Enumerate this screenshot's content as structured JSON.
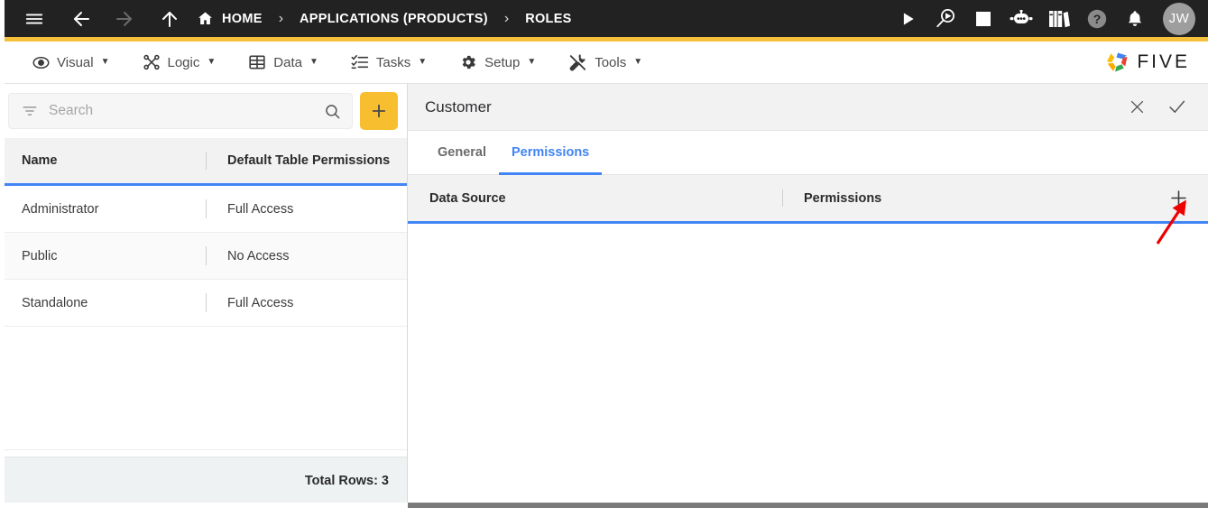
{
  "topbar": {
    "background": "#222222",
    "accent": "#F6C13A",
    "nav_icons": [
      {
        "name": "menu-icon",
        "label": "Menu"
      },
      {
        "name": "back-arrow-icon",
        "label": "Back"
      },
      {
        "name": "forward-arrow-icon",
        "label": "Forward"
      },
      {
        "name": "up-arrow-icon",
        "label": "Up"
      }
    ],
    "breadcrumb": [
      {
        "label": "HOME",
        "icon": "home-icon"
      },
      {
        "label": "APPLICATIONS (PRODUCTS)",
        "icon": ""
      },
      {
        "label": "ROLES",
        "icon": ""
      }
    ],
    "separator": "›",
    "action_icons": [
      {
        "name": "run-icon",
        "label": "Run"
      },
      {
        "name": "debug-search-icon",
        "label": "Debug"
      },
      {
        "name": "stop-icon",
        "label": "Stop"
      },
      {
        "name": "chat-bot-icon",
        "label": "Assistant"
      },
      {
        "name": "library-books-icon",
        "label": "Documentation"
      },
      {
        "name": "help-icon",
        "label": "Help"
      },
      {
        "name": "notification-bell-icon",
        "label": "Notifications"
      }
    ],
    "avatar": {
      "initials": "JW",
      "color": "#9e9e9e"
    }
  },
  "menubar": {
    "items": [
      {
        "label": "Visual",
        "icon": "eye-icon",
        "caret": "▼"
      },
      {
        "label": "Logic",
        "icon": "logic-nodes-icon",
        "caret": "▼"
      },
      {
        "label": "Data",
        "icon": "table-grid-icon",
        "caret": "▼"
      },
      {
        "label": "Tasks",
        "icon": "checklist-icon",
        "caret": "▼"
      },
      {
        "label": "Setup",
        "icon": "gear-icon",
        "caret": "▼"
      },
      {
        "label": "Tools",
        "icon": "tools-hammer-wrench-icon",
        "caret": "▼"
      }
    ],
    "brand": {
      "text": "FIVE",
      "logo": "five-pinwheel-logo"
    }
  },
  "left_panel": {
    "search": {
      "placeholder": "Search",
      "value": "",
      "filter_icon": "filter-icon",
      "search_icon": "search-icon"
    },
    "add_button": {
      "label": "+",
      "name": "add-record-button",
      "color": "#F7BE2F"
    },
    "table": {
      "columns": [
        "Name",
        "Default Table Permissions"
      ],
      "rows": [
        {
          "name": "Administrator",
          "permissions": "Full Access"
        },
        {
          "name": "Public",
          "permissions": "No Access"
        },
        {
          "name": "Standalone",
          "permissions": "Full Access"
        }
      ],
      "footer": "Total Rows: 3"
    }
  },
  "right_panel": {
    "title": "Customer",
    "header_actions": [
      {
        "name": "close-icon",
        "label": "✕"
      },
      {
        "name": "check-icon",
        "label": "✓"
      }
    ],
    "tabs": [
      {
        "label": "General",
        "active": false
      },
      {
        "label": "Permissions",
        "active": true
      }
    ],
    "accent": "#4285F4",
    "table": {
      "columns": [
        "Data Source",
        "Permissions"
      ],
      "add_column_label": "+",
      "rows": []
    }
  },
  "annotation": {
    "type": "arrow",
    "color": "#EE0000",
    "points_to": "add-permission-button"
  }
}
